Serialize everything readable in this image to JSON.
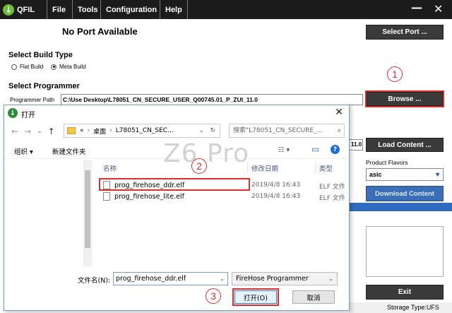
{
  "app": {
    "logo_glyph": "↓",
    "title": "QFIL",
    "menu": [
      "File",
      "Tools",
      "Configuration",
      "Help"
    ],
    "minimize": "—",
    "close": "✕"
  },
  "port": {
    "title": "No Port Available",
    "select_port": "Select Port ..."
  },
  "build_type": {
    "heading": "Select Build Type",
    "options": [
      "Flat Build",
      "Meta Build"
    ],
    "selected": "Meta Build"
  },
  "programmer": {
    "heading": "Select Programmer",
    "path_label": "Programmer Path",
    "path_value": "C:\\Use                 Desktop\\L78051_CN_SECURE_USER_Q00745.01_P_ZUI_11.0",
    "browse": "Browse ..."
  },
  "content": {
    "path_tail": "11.0",
    "load_content": "Load Content ...",
    "product_flavors_label": "Product Flavors",
    "product_flavor": "asic",
    "download_content": "Download Content",
    "exit": "Exit",
    "storage_type": "Storage Type:UFS"
  },
  "annotations": [
    "1",
    "2",
    "3"
  ],
  "dialog": {
    "icon": "↓",
    "title": "打开",
    "close": "✕",
    "nav": {
      "back": "←",
      "forward": "→",
      "recent": "⌄",
      "up": "↑"
    },
    "address": {
      "prefix": "«",
      "parts": [
        "桌面",
        "L78051_CN_SEC..."
      ],
      "dropdown": "⌄",
      "refresh": "↻"
    },
    "search_placeholder": "搜索\"L78051_CN_SECURE_...",
    "search_icon": "⌕",
    "toolbar": {
      "organize": "组织 ▾",
      "new_folder": "新建文件夹",
      "view": "☷ ▾",
      "pane": "▭",
      "help": "?"
    },
    "watermark": "Z6 Pro",
    "columns": [
      "名称",
      "修改日期",
      "类型"
    ],
    "files": [
      {
        "name": "prog_firehose_ddr.elf",
        "date": "2019/4/8 16:43",
        "type": "ELF 文件"
      },
      {
        "name": "prog_firehose_lite.elf",
        "date": "2019/4/8 16:43",
        "type": "ELF 文件"
      }
    ],
    "filename_label": "文件名(N):",
    "filename_value": "prog_firehose_ddr.elf",
    "filetype": "FireHose Programmer",
    "open_btn": "打开(O)",
    "cancel_btn": "取消"
  }
}
